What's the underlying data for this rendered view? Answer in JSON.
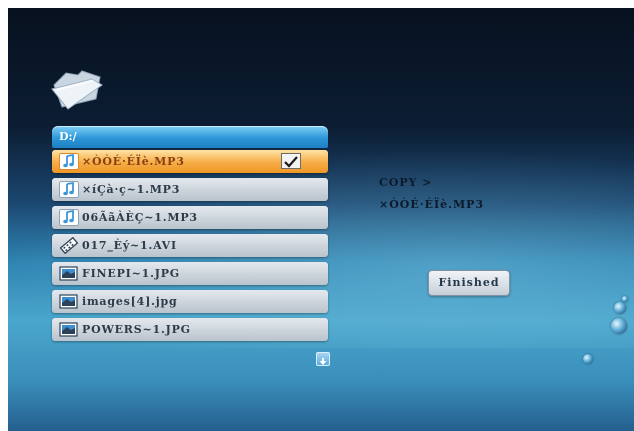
{
  "browser": {
    "path": "D:/",
    "files": [
      {
        "name": "×ÒÒÉ·ÉÏè.MP3",
        "type": "music",
        "icon": "music-note-icon",
        "selected": true,
        "checked": true
      },
      {
        "name": "×íÇà·ç~1.MP3",
        "type": "music",
        "icon": "music-note-icon",
        "selected": false,
        "checked": false
      },
      {
        "name": "06ÃãÀÈÇ~1.MP3",
        "type": "music",
        "icon": "music-note-icon",
        "selected": false,
        "checked": false
      },
      {
        "name": "017_Èý~1.AVI",
        "type": "video",
        "icon": "film-icon",
        "selected": false,
        "checked": false
      },
      {
        "name": "FINEPI~1.JPG",
        "type": "image",
        "icon": "picture-icon",
        "selected": false,
        "checked": false
      },
      {
        "name": "images[4].jpg",
        "type": "image",
        "icon": "picture-icon",
        "selected": false,
        "checked": false
      },
      {
        "name": "POWERS~1.JPG",
        "type": "image",
        "icon": "picture-icon",
        "selected": false,
        "checked": false
      }
    ]
  },
  "copy_panel": {
    "title": "COPY >",
    "filename": "×ÒÒÉ·ÉÏè.MP3",
    "finished_label": "Finished"
  },
  "colors": {
    "selected_row": "#f6ac45",
    "normal_row": "#c9d2da",
    "path_bar": "#2c97d8"
  }
}
